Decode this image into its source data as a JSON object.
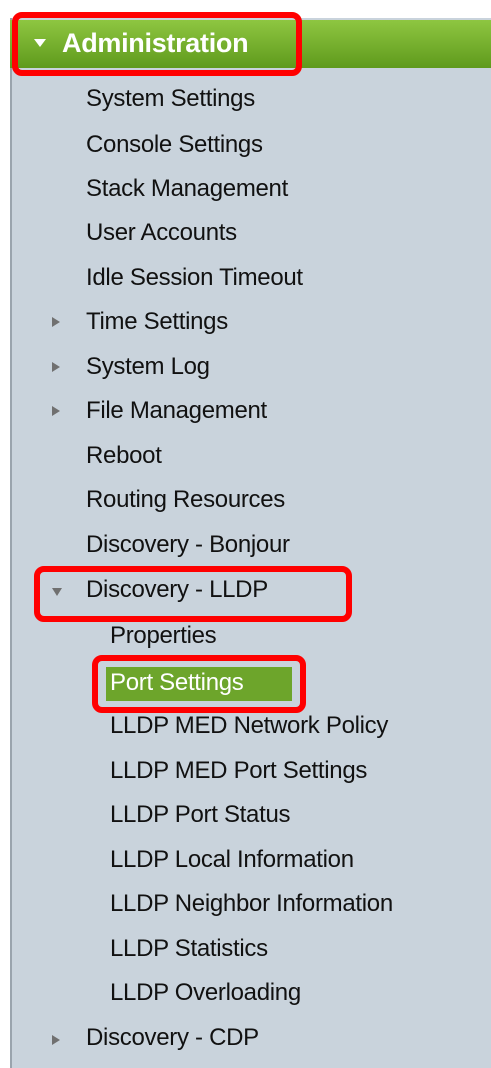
{
  "header": {
    "title": "Administration",
    "icon": "triangle-down-icon"
  },
  "menu": {
    "items": [
      {
        "label": "System Settings"
      },
      {
        "label": "Console Settings"
      },
      {
        "label": "Stack Management"
      },
      {
        "label": "User Accounts"
      },
      {
        "label": "Idle Session Timeout"
      },
      {
        "label": "Time Settings",
        "expander": "collapsed"
      },
      {
        "label": "System Log",
        "expander": "collapsed"
      },
      {
        "label": "File Management",
        "expander": "collapsed"
      },
      {
        "label": "Reboot"
      },
      {
        "label": "Routing Resources"
      },
      {
        "label": "Discovery - Bonjour"
      },
      {
        "label": "Discovery - LLDP",
        "expander": "expanded"
      },
      {
        "label": "Discovery - CDP",
        "expander": "collapsed"
      }
    ],
    "lldp_submenu": [
      {
        "label": "Properties"
      },
      {
        "label": "Port Settings",
        "selected": true
      },
      {
        "label": "LLDP MED Network Policy"
      },
      {
        "label": "LLDP MED Port Settings"
      },
      {
        "label": "LLDP Port Status"
      },
      {
        "label": "LLDP Local Information"
      },
      {
        "label": "LLDP Neighbor Information"
      },
      {
        "label": "LLDP Statistics"
      },
      {
        "label": "LLDP Overloading"
      }
    ]
  },
  "colors": {
    "header_green": "#6da52b",
    "panel_bg": "#c9d3dc",
    "highlight_red": "#ff0000",
    "selected_bg": "#6da52b"
  }
}
